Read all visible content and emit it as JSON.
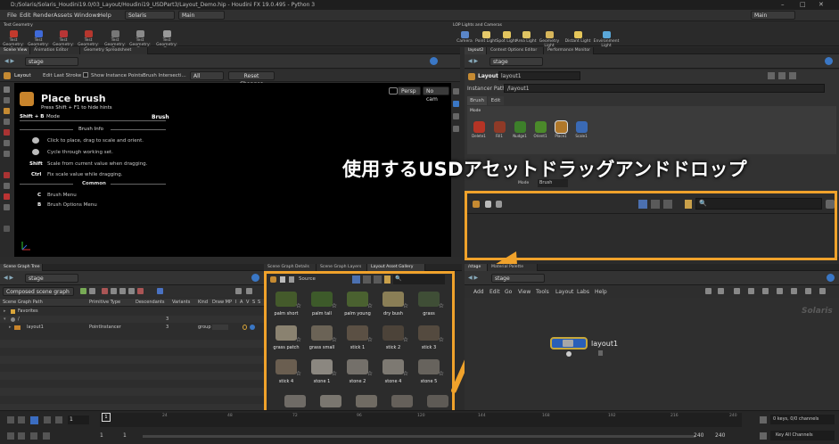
{
  "title": "D:/Solaris/Solaris_Houdini19.0/03_Layout/Houdini19_USDPart3/Layout_Demo.hip - Houdini FX 19.0.495 - Python 3",
  "menu": [
    "File",
    "Edit",
    "Render",
    "Assets",
    "Windows",
    "Help"
  ],
  "desktop": "Solaris",
  "desktop_right": "Main",
  "main_label": "Main",
  "shelf_left_tab": "Test Geometry",
  "shelf_left_tools": [
    "Test Geometry: P...",
    "Test Geometry: R...",
    "Test Geometry: K...",
    "Test Geometry: S...",
    "Test Geometry: T...",
    "Test Geometry: T...",
    "Test Geometry: T..."
  ],
  "shelf_right_tab": "LOP Lights and Cameras",
  "shelf_right_tools": [
    "Camera",
    "Point Light",
    "Spot Light",
    "Area Light",
    "Geometry Light",
    "Distant Light",
    "Environment Light"
  ],
  "left_tabs": [
    "Scene View",
    "Animation Editor",
    "Geometry Spreadsheet"
  ],
  "path_stage": "stage",
  "viewer_toolbar": {
    "layout": "Layout",
    "edit_last": "Edit Last Stroke",
    "show_points": "Show Instance Points",
    "brush_inter": "Brush Intersecti...",
    "all": "All",
    "reset": "Reset Changes"
  },
  "viewport": {
    "persp": "Persp",
    "nocam": "No cam",
    "place_brush": "Place brush",
    "hint": "Press Shift + F1 to hide hints",
    "shortcut": "Shift + B",
    "mode": "Mode",
    "brush": "Brush",
    "brush_info": "Brush Info",
    "info_lines": [
      "Click to place, drag to scale and orient.",
      "Cycle through working set.",
      "Scale from current value when dragging.",
      "Fix scale value while dragging."
    ],
    "info_keys": [
      "",
      "",
      "Shift",
      "Ctrl"
    ],
    "common": "Common",
    "common_lines": [
      "Brush Menu",
      "Brush Options Menu"
    ],
    "common_keys": [
      "C",
      "B"
    ]
  },
  "right_tabs": [
    "layout2",
    "Context Options Editor",
    "Performance Monitor"
  ],
  "params": {
    "type": "Layout",
    "name": "layout1",
    "instancer_label": "Instancer Path",
    "instancer_value": "/layout1",
    "tabs": [
      "Brush",
      "Edit"
    ],
    "mode_label": "Mode",
    "mode_value": "Brush"
  },
  "brushes": [
    "Delete1",
    "Fill1",
    "Nudge1",
    "Orient1",
    "Place1",
    "Scale1"
  ],
  "overlay_text": "使用するUSDアセットドラッグアンドドロップ",
  "scene_tabs": [
    "Scene Graph Tree"
  ],
  "scene_dd": "Composed scene graph",
  "scene_headers": [
    "Scene Graph Path",
    "Primitive Type",
    "Descendants",
    "Variants",
    "Kind",
    "Draw M",
    "P",
    "I",
    "A",
    "V",
    "S",
    "S"
  ],
  "scene_rows": [
    {
      "path": "Favorites",
      "type": "",
      "desc": "",
      "var": "",
      "kind": ""
    },
    {
      "path": "/",
      "type": "",
      "desc": "3",
      "var": "",
      "kind": ""
    },
    {
      "path": "layout1",
      "type": "PointInstancer",
      "desc": "3",
      "var": "",
      "kind": "group"
    }
  ],
  "mid_tabs": [
    "Scene Graph Details",
    "Scene Graph Layers",
    "Layout Asset Gallery"
  ],
  "gallery_source": "Source",
  "assets": [
    "palm short",
    "palm tall",
    "palm young",
    "dry bush",
    "grass",
    "grass patch",
    "grass small",
    "stick 1",
    "stick 2",
    "stick 3",
    "stick 4",
    "stone 1",
    "stone 2",
    "stone 4",
    "stone 5"
  ],
  "network_tabs": [
    "/stage",
    "Material Palette"
  ],
  "network_path": "stage",
  "network_menu": [
    "Add",
    "Edit",
    "Go",
    "View",
    "Tools",
    "Layout",
    "Labs",
    "Help"
  ],
  "solaris_watermark": "Solaris",
  "node_label": "layout1",
  "timeline": {
    "frame": "1",
    "ticks": [
      "24",
      "48",
      "72",
      "96",
      "120",
      "144",
      "168",
      "192",
      "216",
      "240"
    ],
    "start": "1",
    "start2": "1",
    "end": "240",
    "end2": "240",
    "keys": "0 keys, 0/0 channels",
    "allch": "Key All Channels"
  },
  "colors": {
    "accent": "#f0a22b",
    "bg": "#2b2b2b",
    "viewport": "#000000",
    "node_blue": "#2a5fb7"
  }
}
